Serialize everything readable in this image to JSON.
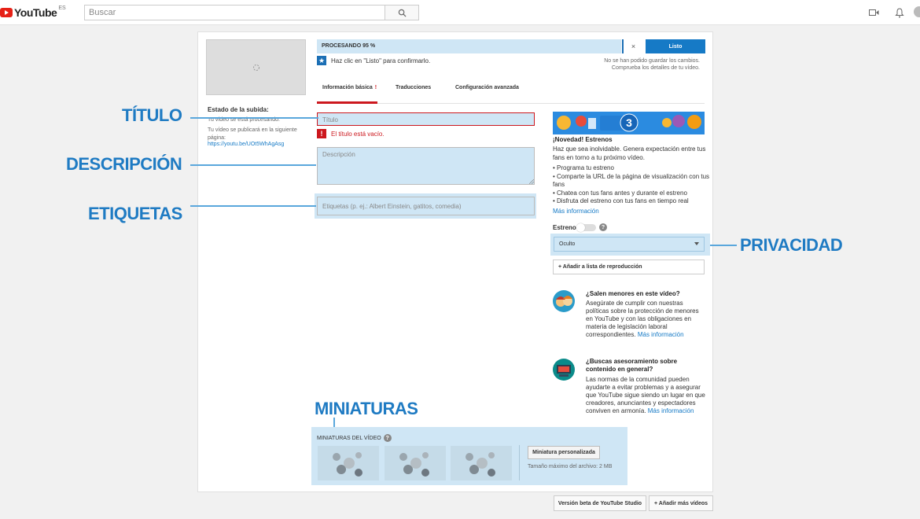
{
  "header": {
    "logo_text": "YouTube",
    "region": "ES",
    "search_placeholder": "Buscar"
  },
  "upload_status": {
    "title": "Estado de la subida:",
    "processing": "Tu vídeo se está procesando.",
    "publish_note": "Tu vídeo se publicará en la siguiente página:",
    "link": "https://youtu.be/UOt5WhAgAsg"
  },
  "progress": {
    "label": "PROCESANDO 95 %",
    "percent": 95,
    "close": "×",
    "done_button": "Listo",
    "confirm": "Haz clic en \"Listo\" para confirmarlo.",
    "save_error_1": "No se han podido guardar los cambios.",
    "save_error_2": "Comprueba los detalles de tu vídeo."
  },
  "tabs": [
    {
      "label": "Información básica",
      "active": true,
      "error": "!"
    },
    {
      "label": "Traducciones"
    },
    {
      "label": "Configuración avanzada"
    }
  ],
  "form": {
    "title_placeholder": "Título",
    "title_error_icon": "!",
    "title_error": "El título está vacío.",
    "description_placeholder": "Descripción",
    "tags_placeholder": "Etiquetas (p. ej.: Albert Einstein, gatitos, comedia)"
  },
  "premiere": {
    "banner_number": "3",
    "news_title": "¡Novedad! Estrenos",
    "news_body": "Haz que sea inolvidable. Genera expectación entre tus fans en torno a tu próximo vídeo.",
    "bullets": [
      "• Programa tu estreno",
      "• Comparte la URL de la página de visualización con tus fans",
      "• Chatea con tus fans antes y durante el estreno",
      "• Disfruta del estreno con tus fans en tiempo real"
    ],
    "more_info": "Más información",
    "toggle_label": "Estreno",
    "help": "?"
  },
  "privacy": {
    "selected": "Oculto",
    "add_playlist": "+ Añadir a lista de reproducción"
  },
  "kids": {
    "title": "¿Salen menores en este vídeo?",
    "body": "Asegúrate de cumplir con nuestras políticas sobre la protección de menores en YouTube y con las obligaciones en materia de legislación laboral correspondientes.",
    "link": "Más información"
  },
  "advice": {
    "title": "¿Buscas asesoramiento sobre contenido en general?",
    "body": "Las normas de la comunidad pueden ayudarte a evitar problemas y a asegurar que YouTube sigue siendo un lugar en que creadores, anunciantes y espectadores conviven en armonía.",
    "link": "Más información"
  },
  "thumbnails": {
    "label": "MINIATURAS DEL VÍDEO",
    "custom_button": "Miniatura personalizada",
    "max_size": "Tamaño máximo del archivo: 2 MB"
  },
  "footer": {
    "studio_beta": "Versión beta de YouTube Studio",
    "add_more": "+ Añadir más vídeos"
  },
  "annotations": {
    "titulo": "TÍTULO",
    "descripcion": "DESCRIPCIÓN",
    "etiquetas": "ETIQUETAS",
    "privacidad": "PRIVACIDAD",
    "miniaturas": "MINIATURAS"
  },
  "colors": {
    "accent_blue": "#167ac6",
    "highlight": "#cfe6f5",
    "annotation": "#1f7bc3",
    "error_red": "#cc181e"
  }
}
